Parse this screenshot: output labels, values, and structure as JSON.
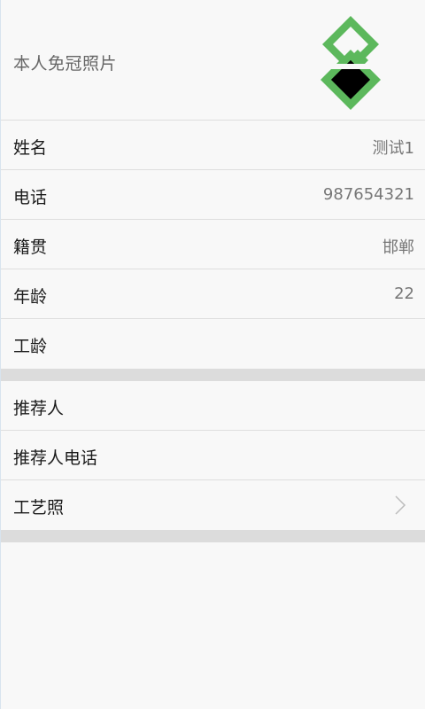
{
  "photo": {
    "label": "本人免冠照片",
    "thumbnail_icon": "placeholder-image-icon",
    "thumbnail_color": "#5cb85c"
  },
  "basic_info": [
    {
      "label": "姓名",
      "value": "测试1"
    },
    {
      "label": "电话",
      "value": "987654321"
    },
    {
      "label": "籍贯",
      "value": "邯郸"
    },
    {
      "label": "年龄",
      "value": "22"
    },
    {
      "label": "工龄",
      "value": ""
    }
  ],
  "referral": [
    {
      "label": "推荐人",
      "value": ""
    },
    {
      "label": "推荐人电话",
      "value": ""
    },
    {
      "label": "工艺照",
      "value": "",
      "icon": "chevron-right-icon"
    }
  ]
}
